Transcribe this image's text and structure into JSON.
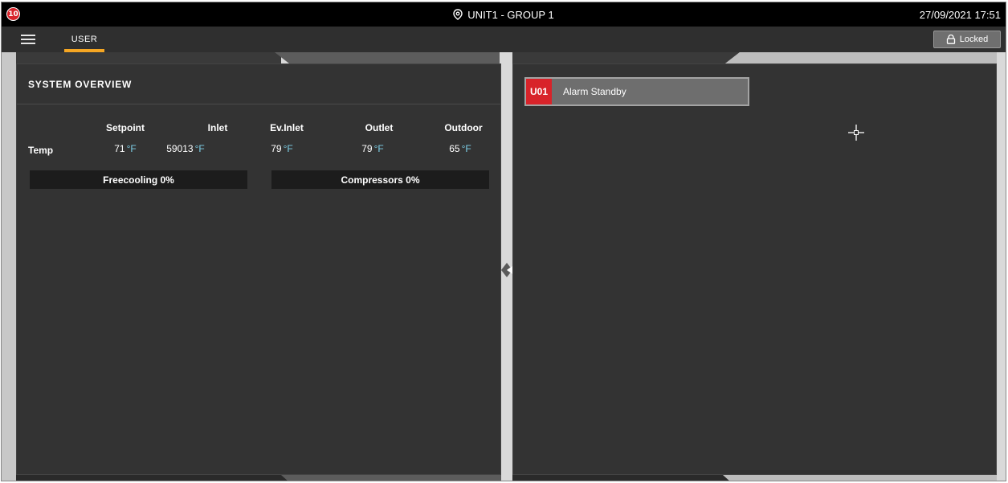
{
  "header": {
    "logo_text": "10",
    "unit_title": "UNIT1 - GROUP 1",
    "datetime": "27/09/2021 17:51"
  },
  "nav": {
    "tabs": [
      {
        "label": "USER",
        "active": true
      }
    ],
    "locked_label": "Locked"
  },
  "system_overview": {
    "title": "SYSTEM OVERVIEW",
    "columns": [
      "Setpoint",
      "Inlet",
      "Ev.Inlet",
      "Outlet",
      "Outdoor"
    ],
    "row_label": "Temp",
    "values": [
      {
        "value": "71",
        "unit": "°F"
      },
      {
        "value": "59013",
        "unit": "°F"
      },
      {
        "value": "79",
        "unit": "°F"
      },
      {
        "value": "79",
        "unit": "°F"
      },
      {
        "value": "65",
        "unit": "°F"
      }
    ],
    "freecooling_label": "Freecooling 0%",
    "compressors_label": "Compressors 0%"
  },
  "alarms": [
    {
      "code": "U01",
      "text": "Alarm Standby"
    }
  ],
  "colors": {
    "accent": "#f5a623",
    "alarm_red": "#d8232a",
    "panel_bg": "#333333",
    "topbar_bg": "#000000"
  },
  "icons": {
    "location": "location-pin-icon",
    "menu": "hamburger-menu-icon",
    "lock": "lock-icon",
    "cursor": "crosshair-cursor-icon"
  }
}
